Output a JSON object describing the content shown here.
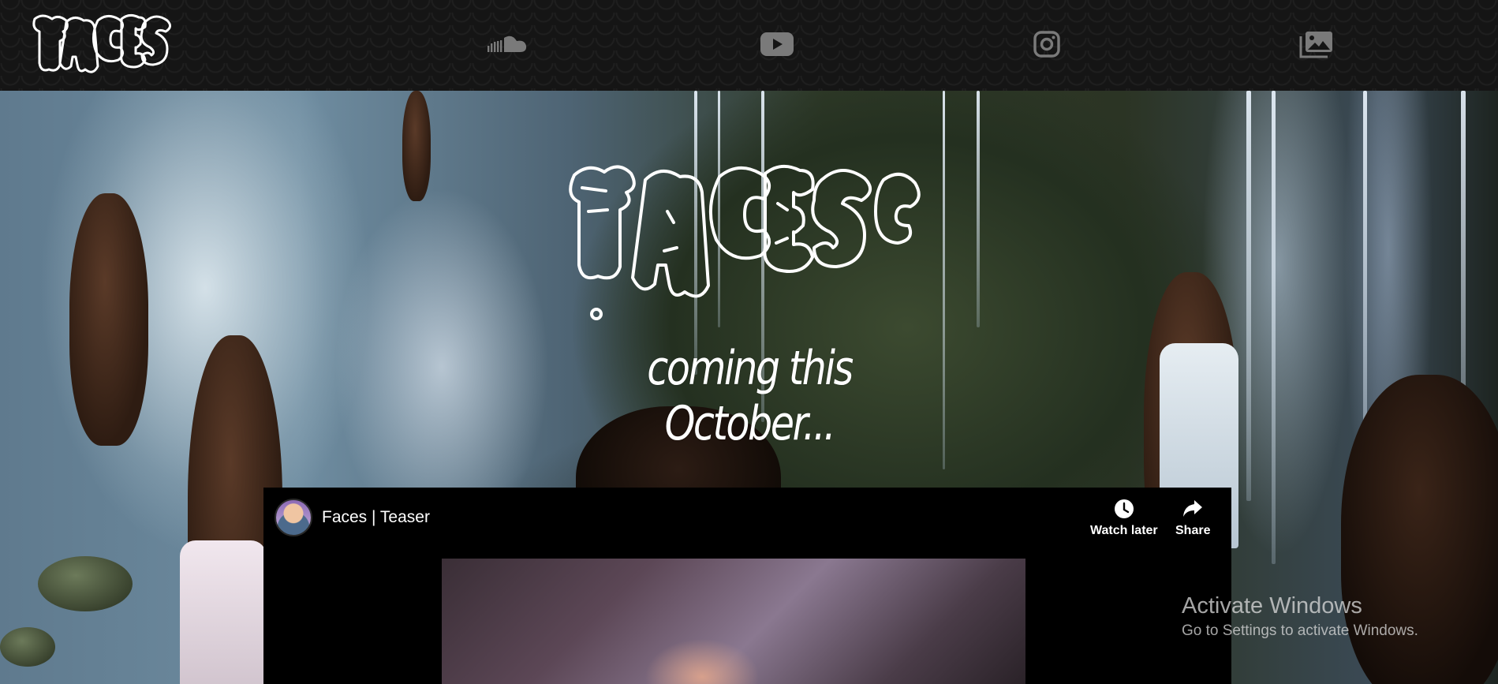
{
  "nav": {
    "logo_text": "FACES",
    "icons": [
      "soundcloud-icon",
      "youtube-icon",
      "instagram-icon",
      "gallery-icon"
    ],
    "icon_color": "#7a7a7a"
  },
  "hero": {
    "logo_text": "FACES",
    "tagline": "coming this October..."
  },
  "video": {
    "title": "Faces | Teaser",
    "watch_later": "Watch later",
    "share": "Share"
  },
  "watermark": {
    "line1": "Activate Windows",
    "line2": "Go to Settings to activate Windows."
  }
}
